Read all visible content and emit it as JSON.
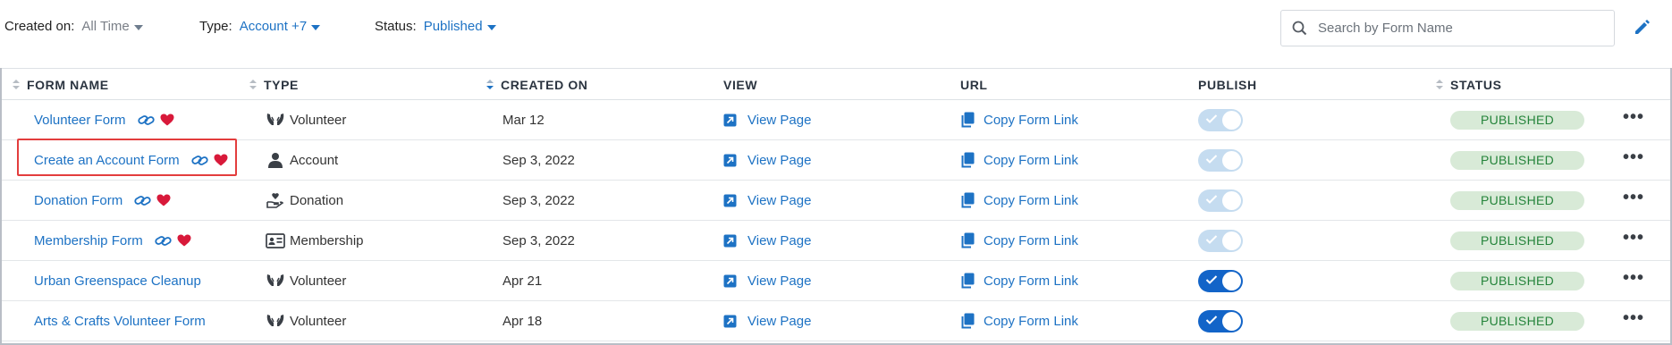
{
  "filters": {
    "created_label": "Created on:",
    "created_value": "All Time",
    "type_label": "Type:",
    "type_value": "Account +7",
    "status_label": "Status:",
    "status_value": "Published"
  },
  "search": {
    "placeholder": "Search by Form Name"
  },
  "columns": {
    "form_name": "FORM NAME",
    "type": "TYPE",
    "created_on": "CREATED ON",
    "view": "VIEW",
    "url": "URL",
    "publish": "PUBLISH",
    "status": "STATUS"
  },
  "rows": [
    {
      "name": "Volunteer Form",
      "type": "Volunteer",
      "type_icon": "hands-icon",
      "created": "Mar 12",
      "view": "View Page",
      "url": "Copy Form Link",
      "publish_on": false,
      "status": "PUBLISHED"
    },
    {
      "name": "Create an Account Form",
      "type": "Account",
      "type_icon": "person-icon",
      "created": "Sep 3, 2022",
      "view": "View Page",
      "url": "Copy Form Link",
      "publish_on": false,
      "status": "PUBLISHED"
    },
    {
      "name": "Donation Form",
      "type": "Donation",
      "type_icon": "hand-heart-icon",
      "created": "Sep 3, 2022",
      "view": "View Page",
      "url": "Copy Form Link",
      "publish_on": false,
      "status": "PUBLISHED"
    },
    {
      "name": "Membership Form",
      "type": "Membership",
      "type_icon": "id-card-icon",
      "created": "Sep 3, 2022",
      "view": "View Page",
      "url": "Copy Form Link",
      "publish_on": false,
      "status": "PUBLISHED"
    },
    {
      "name": "Urban Greenspace Cleanup",
      "type": "Volunteer",
      "type_icon": "hands-icon",
      "created": "Apr 21",
      "view": "View Page",
      "url": "Copy Form Link",
      "publish_on": true,
      "status": "PUBLISHED"
    },
    {
      "name": "Arts & Crafts Volunteer Form",
      "type": "Volunteer",
      "type_icon": "hands-icon",
      "created": "Apr 18",
      "view": "View Page",
      "url": "Copy Form Link",
      "publish_on": true,
      "status": "PUBLISHED"
    }
  ],
  "more_glyph": "•••",
  "colors": {
    "link": "#1d72c4",
    "badge_bg": "#d8ead7",
    "badge_text": "#25843b",
    "toggle_on": "#1264c8",
    "toggle_off": "#c5dcf0",
    "heart": "#d8193a",
    "highlight": "#e33d3d"
  }
}
